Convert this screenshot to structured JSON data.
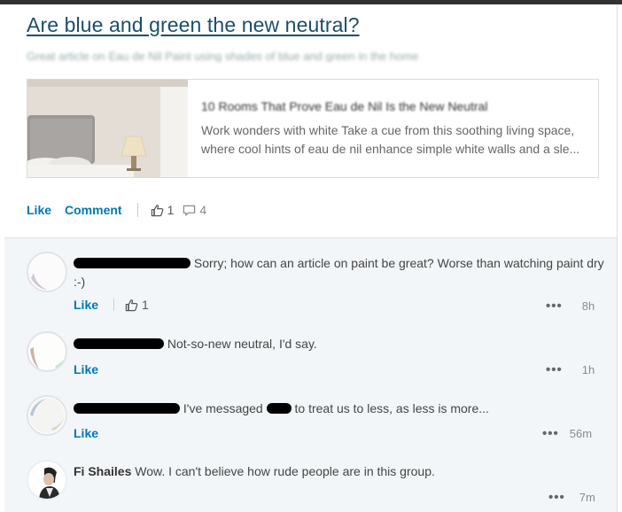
{
  "post": {
    "title": "Are blue and green the new neutral?",
    "subtitle": "Great article on Eau de Nil Paint using shades of blue and green in the home",
    "card": {
      "title": "10 Rooms That Prove Eau de Nil Is the New Neutral",
      "description": "Work wonders with white Take a cue from this soothing living space, where cool hints of eau de nil enhance simple white walls and a sle..."
    },
    "actions": {
      "like": "Like",
      "comment": "Comment",
      "like_count": "1",
      "comment_count": "4"
    }
  },
  "comments": [
    {
      "text": "Sorry; how can an article on paint be great? Worse than watching paint dry :-)",
      "like": "Like",
      "like_count": "1",
      "time": "8h"
    },
    {
      "text": "Not-so-new neutral, I'd say.",
      "like": "Like",
      "time": "1h"
    },
    {
      "text_before": "I've messaged",
      "text_after": "to treat us to less, as less is more...",
      "like": "Like",
      "time": "56m"
    },
    {
      "author": "Fi Shailes",
      "text": "Wow. I can't believe how rude people are in this group.",
      "time": "7m"
    }
  ],
  "menu_glyph": "•••",
  "colors": {
    "link_blue": "#0077b5",
    "title_blue": "#1b4e6b",
    "comment_bg": "#f3f6f8"
  }
}
